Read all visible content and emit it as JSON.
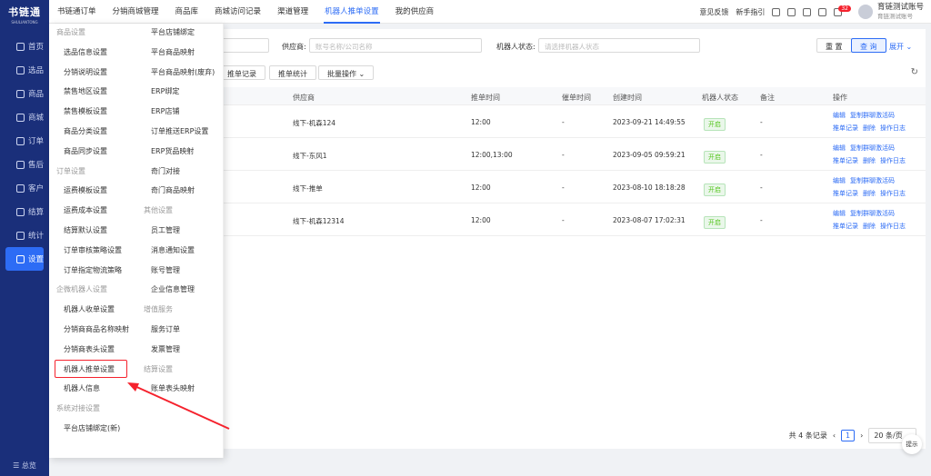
{
  "app": {
    "title": "书链通",
    "subtitle": "SHULIANTONG"
  },
  "sidebar": {
    "items": [
      {
        "label": "首页"
      },
      {
        "label": "选品"
      },
      {
        "label": "商品"
      },
      {
        "label": "商城"
      },
      {
        "label": "订单"
      },
      {
        "label": "售后"
      },
      {
        "label": "客户"
      },
      {
        "label": "结算"
      },
      {
        "label": "统计"
      },
      {
        "label": "设置"
      }
    ],
    "bottom": "总览"
  },
  "tabs": [
    "书链通订单",
    "分销商城管理",
    "商品库",
    "商城访问记录",
    "渠道管理",
    "机器人推单设置",
    "我的供应商"
  ],
  "topright": {
    "feedback": "意见反馈",
    "guide": "新手指引",
    "badge": "32",
    "account_name": "育链测试账号",
    "account_sub": "育链测试账号"
  },
  "filter": {
    "supplier_label": "供应商:",
    "supplier_placeholder": "账号名称/公司名称",
    "robot_label": "机器人状态:",
    "robot_placeholder": "请选择机器人状态",
    "reset": "重 置",
    "query": "查 询",
    "expand": "展开"
  },
  "toolbar": {
    "push_record": "推单记录",
    "push_stats": "推单统计",
    "batch": "批量操作"
  },
  "table": {
    "headers": [
      "供应商",
      "推单时间",
      "催单时间",
      "创建时间",
      "机器人状态",
      "备注",
      "操作"
    ],
    "rows": [
      {
        "supplier": "线下-机森124",
        "push": "12:00",
        "urge": "-",
        "created": "2023-09-21 14:49:55",
        "status": "开启",
        "note": "-"
      },
      {
        "supplier": "线下-东风1",
        "push": "12:00,13:00",
        "urge": "-",
        "created": "2023-09-05 09:59:21",
        "status": "开启",
        "note": "-"
      },
      {
        "supplier": "线下-推单",
        "push": "12:00",
        "urge": "-",
        "created": "2023-08-10 18:18:28",
        "status": "开启",
        "note": "-"
      },
      {
        "supplier": "线下-机森12314",
        "push": "12:00",
        "urge": "-",
        "created": "2023-08-07 17:02:31",
        "status": "开启",
        "note": "-"
      }
    ],
    "ops": {
      "edit": "编辑",
      "copy": "复制群聊激活码",
      "record": "推单记录",
      "del": "删除",
      "log": "操作日志"
    }
  },
  "pager": {
    "total": "共 4 条记录",
    "page": "1",
    "size": "20 条/页"
  },
  "help": "提示",
  "menu": {
    "col1": [
      "商品设置",
      "选品信息设置",
      "分销说明设置",
      "禁售地区设置",
      "禁售模板设置",
      "商品分类设置",
      "商品同步设置",
      "订单设置",
      "运费模板设置",
      "运费成本设置",
      "结算默认设置",
      "订单审核策略设置",
      "订单指定物流策略",
      "企微机器人设置",
      "机器人收单设置",
      "分销商商品名称映射",
      "分销商表头设置",
      "机器人推单设置",
      "机器人信息",
      "系统对接设置",
      "平台店铺绑定(新)"
    ],
    "col2": [
      "平台店铺绑定",
      "平台商品映射",
      "平台商品映射(废弃)",
      "ERP绑定",
      "ERP店铺",
      "订单推送ERP设置",
      "ERP货品映射",
      "奇门对接",
      "奇门商品映射",
      "其他设置",
      "员工管理",
      "消息通知设置",
      "账号管理",
      "企业信息管理",
      "增值服务",
      "服务订单",
      "发票管理",
      "结算设置",
      "账单表头映射"
    ]
  }
}
